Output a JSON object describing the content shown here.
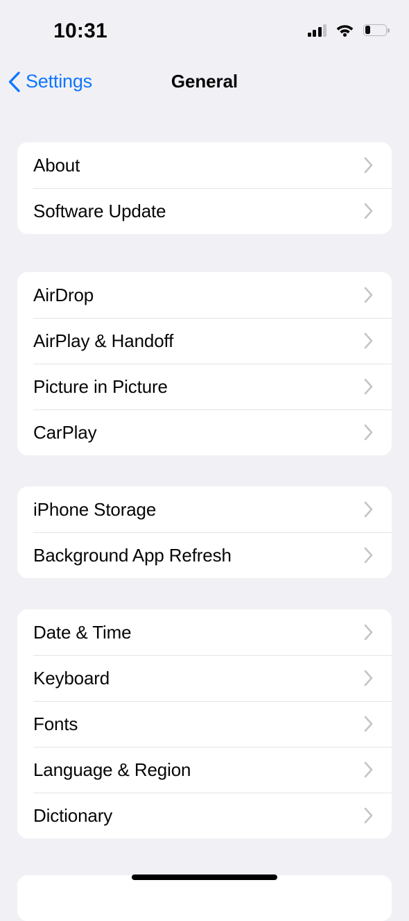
{
  "status_bar": {
    "time": "10:31",
    "cellular_icon": "cellular-signal-icon",
    "cellular_bars_filled": 3,
    "cellular_bars_total": 4,
    "wifi_icon": "wifi-icon",
    "battery_icon": "battery-icon",
    "battery_level_percent": 26
  },
  "nav": {
    "back_icon": "chevron-left-icon",
    "back_label": "Settings",
    "title": "General"
  },
  "colors": {
    "accent": "#1076ff",
    "background": "#f1f1f5",
    "card": "#ffffff",
    "separator": "#e4e4e7",
    "chevron": "#c3c3c8",
    "text": "#060606"
  },
  "groups": [
    {
      "id": "group-system",
      "rows": [
        {
          "label": "About",
          "chevron": "chevron-right-icon"
        },
        {
          "label": "Software Update",
          "chevron": "chevron-right-icon"
        }
      ]
    },
    {
      "id": "group-sharing",
      "rows": [
        {
          "label": "AirDrop",
          "chevron": "chevron-right-icon"
        },
        {
          "label": "AirPlay & Handoff",
          "chevron": "chevron-right-icon"
        },
        {
          "label": "Picture in Picture",
          "chevron": "chevron-right-icon"
        },
        {
          "label": "CarPlay",
          "chevron": "chevron-right-icon"
        }
      ]
    },
    {
      "id": "group-storage",
      "rows": [
        {
          "label": "iPhone Storage",
          "chevron": "chevron-right-icon"
        },
        {
          "label": "Background App Refresh",
          "chevron": "chevron-right-icon"
        }
      ]
    },
    {
      "id": "group-localization",
      "rows": [
        {
          "label": "Date & Time",
          "chevron": "chevron-right-icon"
        },
        {
          "label": "Keyboard",
          "chevron": "chevron-right-icon"
        },
        {
          "label": "Fonts",
          "chevron": "chevron-right-icon"
        },
        {
          "label": "Language & Region",
          "chevron": "chevron-right-icon"
        },
        {
          "label": "Dictionary",
          "chevron": "chevron-right-icon"
        }
      ]
    },
    {
      "id": "group-partial",
      "rows": []
    }
  ],
  "home_indicator": "home-indicator"
}
